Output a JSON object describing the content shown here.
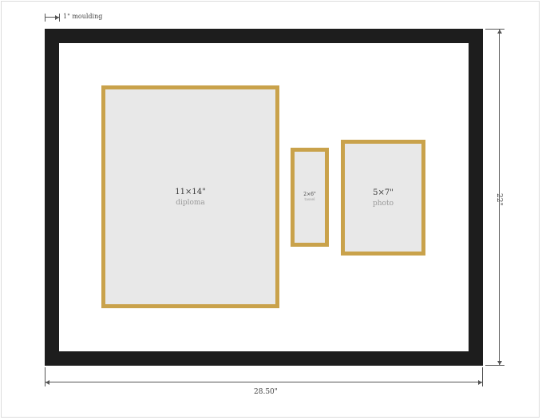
{
  "annotations": {
    "moulding": "1\" moulding",
    "width": "28.50\"",
    "height": "22\""
  },
  "openings": {
    "diploma": {
      "size": "11×14\"",
      "name": "diploma"
    },
    "tassel": {
      "size": "2×6\"",
      "name": "tassel"
    },
    "photo": {
      "size": "5×7\"",
      "name": "photo"
    }
  },
  "colors": {
    "frame": "#1d1d1d",
    "mat": "#ffffff",
    "window_border": "#c9a24b",
    "window_fill": "#e8e8e8"
  }
}
